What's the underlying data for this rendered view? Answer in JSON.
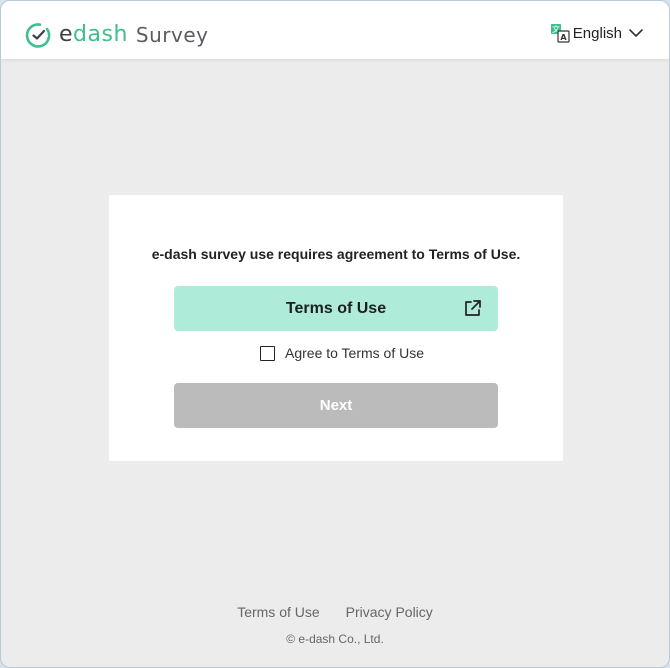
{
  "header": {
    "logo_main_prefix": "e",
    "logo_main_accent": "dash",
    "logo_sub": "Survey",
    "language": "English",
    "language_icon": "translate-icon",
    "dropdown_icon": "chevron-down-icon"
  },
  "card": {
    "message": "e-dash survey use requires agreement to Terms of Use.",
    "terms_button_label": "Terms of Use",
    "terms_button_icon": "external-link-icon",
    "agree_label": "Agree to Terms of Use",
    "agree_checked": false,
    "next_label": "Next",
    "next_disabled": true
  },
  "footer": {
    "links": [
      "Terms of Use",
      "Privacy Policy"
    ],
    "copyright": "© e-dash Co., Ltd."
  },
  "colors": {
    "brand_green": "#3fbf8e",
    "terms_button_bg": "#aeecd9",
    "next_button_disabled_bg": "#bbbbbb",
    "page_bg": "#ececec"
  }
}
